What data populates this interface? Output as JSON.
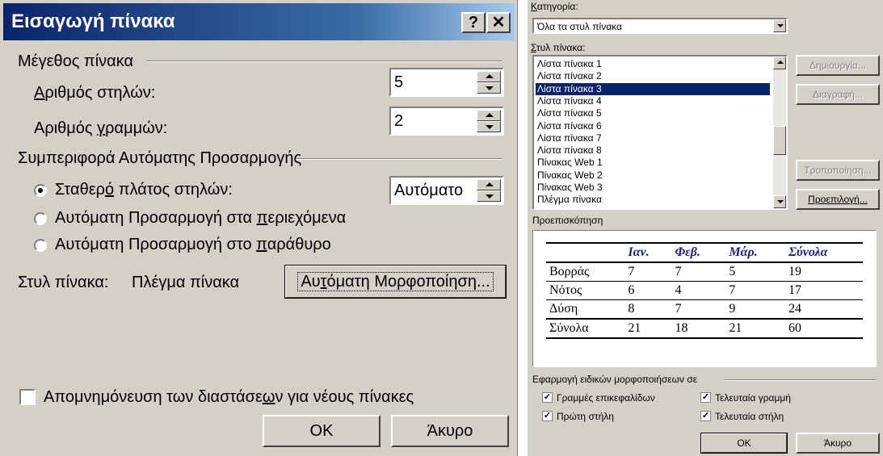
{
  "dialog1": {
    "title": "Εισαγωγή πίνακα",
    "help_btn": "?",
    "close_btn": "✕",
    "size_group": "Μέγεθος πίνακα",
    "cols_label_u": "Α",
    "cols_label_rest": "ριθμός στηλών:",
    "cols_value": "5",
    "rows_label_pre": "Αριθμός ",
    "rows_label_u": "γ",
    "rows_label_rest": "ραμμών:",
    "rows_value": "2",
    "autofit_group": "Συμπεριφορά Αυτόματης Προσαρμογής",
    "fixed_width_pre": "Σταθερ",
    "fixed_width_u": "ό",
    "fixed_width_rest": " πλάτος στηλών:",
    "fixed_width_value": "Αυτόματο",
    "autofit_contents_pre": "Αυτόματη Προσαρμογή στα ",
    "autofit_contents_u": "π",
    "autofit_contents_rest": "εριεχόμενα",
    "autofit_window_pre": "Αυτόματη Προσαρμογή στο ",
    "autofit_window_u": "π",
    "autofit_window_rest": "αράθυρο",
    "table_style_label": "Στυλ πίνακα:",
    "table_style_value": "Πλέγμα πίνακα",
    "autoformat_pre": "Αυ",
    "autoformat_u": "τ",
    "autoformat_rest": "όματη Μορφοποίηση...",
    "remember_pre": "Απομνημόνευση των διαστάσε",
    "remember_u": "ω",
    "remember_rest": "ν για νέους πίνακες",
    "ok": "ΟΚ",
    "cancel": "Άκυρο"
  },
  "dialog2": {
    "category_label_u": "Κ",
    "category_label_rest": "ατηγορία:",
    "category_value": "Όλα τα στυλ πίνακα",
    "styles_label_u": "Σ",
    "styles_label_rest": "τυλ πίνακα:",
    "styles": [
      "Λίστα πίνακα 1",
      "Λίστα πίνακα 2",
      "Λίστα πίνακα 3",
      "Λίστα πίνακα 4",
      "Λίστα πίνακα 5",
      "Λίστα πίνακα 6",
      "Λίστα πίνακα 7",
      "Λίστα πίνακα 8",
      "Πίνακας Web 1",
      "Πίνακας Web 2",
      "Πίνακας Web 3",
      "Πλέγμα πίνακα"
    ],
    "selected_style": "Λίστα πίνακα 3",
    "btn_new": "Δημιουργία...",
    "btn_delete": "Διαγραφή...",
    "btn_modify": "Τροποποίηση...",
    "btn_default": "Προεπιλογή...",
    "preview_label": "Προεπισκόπηση",
    "preview": {
      "header": [
        "",
        "Ιαν.",
        "Φεβ.",
        "Μάρ.",
        "Σύνολα"
      ],
      "rows": [
        [
          "Βορράς",
          "7",
          "7",
          "5",
          "19"
        ],
        [
          "Νότος",
          "6",
          "4",
          "7",
          "17"
        ],
        [
          "Δύση",
          "8",
          "7",
          "9",
          "24"
        ],
        [
          "Σύνολα",
          "21",
          "18",
          "21",
          "60"
        ]
      ]
    },
    "apply_group": "Εφαρμογή ειδικών μορφοποιήσεων σε",
    "chk_header_rows": "Γραμμές επικεφαλίδων",
    "chk_first_col": "Πρώτη στήλη",
    "chk_last_row": "Τελευταία γραμμή",
    "chk_last_col": "Τελευταία στήλη",
    "check_mark": "✓",
    "ok": "ΟΚ",
    "cancel": "Άκυρο"
  }
}
